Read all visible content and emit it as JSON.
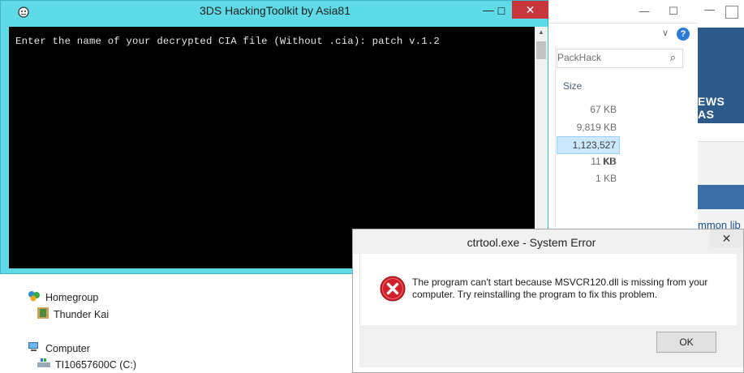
{
  "console": {
    "title": "3DS HackingToolkit by Asia81",
    "min_glyph": "—",
    "max_glyph": "☐",
    "close_glyph": "✕",
    "output": "Enter the name of your decrypted CIA file (Without .cia): patch v.1.2",
    "scroll_up": "▲",
    "scroll_down": "▼"
  },
  "explorer": {
    "min_glyph": "—",
    "max_glyph": "☐",
    "search_placeholder": "PackHack",
    "search_icon": "search-icon",
    "column_size": "Size",
    "sizes": [
      "67 KB",
      "9,819 KB",
      "1,123,527 KB",
      "11 KB",
      "1 KB"
    ],
    "selected_index": 2,
    "nav": {
      "homegroup": "Homegroup",
      "user": "Thunder Kai",
      "computer": "Computer",
      "drive": "TI10657600C (C:)"
    }
  },
  "website": {
    "news_text": "EWS AS",
    "link_text": "mmon lib"
  },
  "dialog": {
    "title": "ctrtool.exe - System Error",
    "close_glyph": "✕",
    "message": "The program can't start because MSVCR120.dll is missing from your computer. Try reinstalling the program to fix this problem.",
    "ok_label": "OK",
    "icon": "error-icon"
  },
  "colors": {
    "console_frame": "#5fdbe8",
    "close_button": "#c7363b",
    "error_red": "#d0202a",
    "site_blue": "#2e5a8a"
  }
}
